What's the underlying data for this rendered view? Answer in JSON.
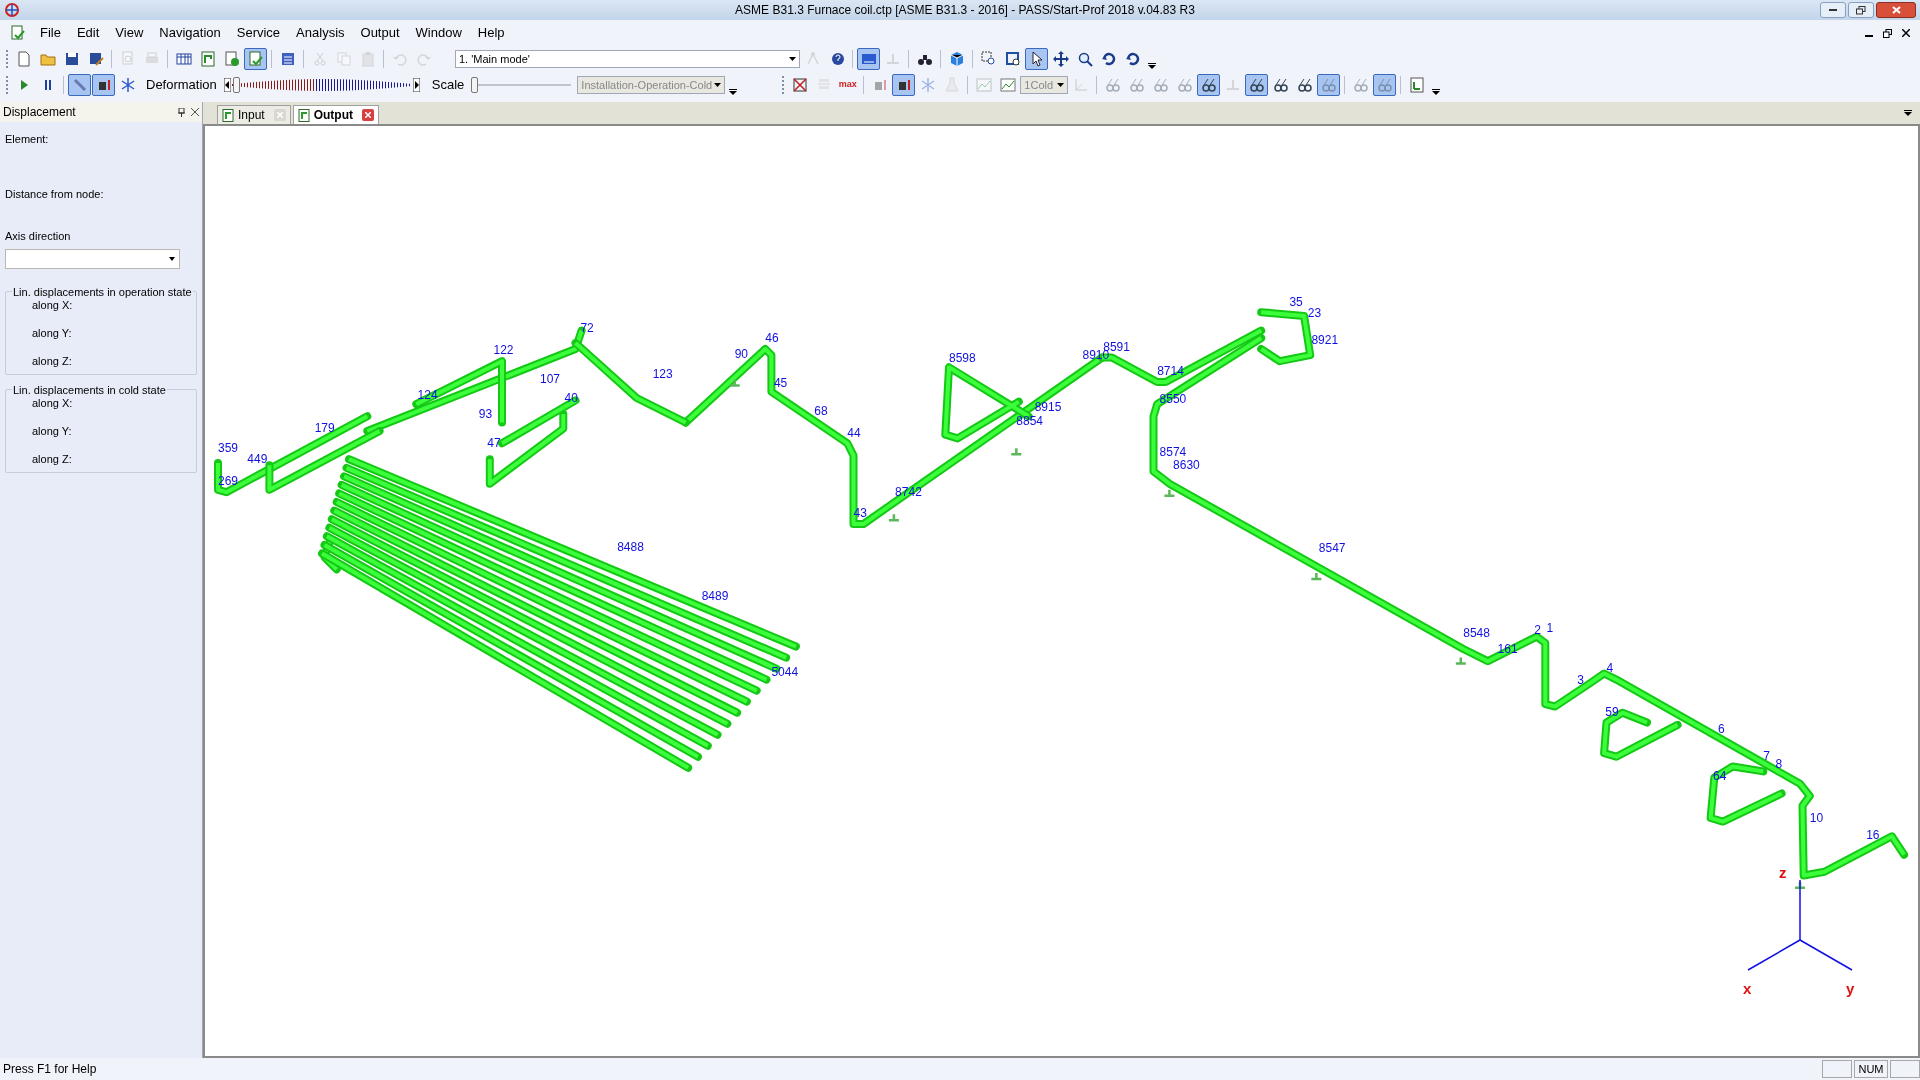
{
  "window": {
    "title": "ASME B31.3 Furnace coil.ctp [ASME B31.3 - 2016] - PASS/Start-Prof 2018 v.04.83 R3"
  },
  "menu": [
    "File",
    "Edit",
    "View",
    "Navigation",
    "Service",
    "Analysis",
    "Output",
    "Window",
    "Help"
  ],
  "toolbar_1": [
    {
      "kind": "new",
      "pressed": false,
      "disabled": false
    },
    {
      "kind": "open",
      "pressed": false,
      "disabled": false
    },
    {
      "kind": "save",
      "pressed": false,
      "disabled": false
    },
    {
      "kind": "saveas",
      "pressed": false,
      "disabled": false
    },
    {
      "kind": "sep"
    },
    {
      "kind": "preview",
      "pressed": false,
      "disabled": true
    },
    {
      "kind": "print",
      "pressed": false,
      "disabled": true
    },
    {
      "kind": "sep"
    },
    {
      "kind": "table",
      "pressed": false,
      "disabled": false
    },
    {
      "kind": "plan",
      "pressed": false,
      "disabled": false
    },
    {
      "kind": "check",
      "pressed": false,
      "disabled": false
    },
    {
      "kind": "calc",
      "pressed": true,
      "disabled": false
    },
    {
      "kind": "sep"
    },
    {
      "kind": "calculator",
      "pressed": false,
      "disabled": false
    },
    {
      "kind": "sep"
    },
    {
      "kind": "cut",
      "pressed": false,
      "disabled": true
    },
    {
      "kind": "copy",
      "pressed": false,
      "disabled": true
    },
    {
      "kind": "paste",
      "pressed": false,
      "disabled": true
    },
    {
      "kind": "sep"
    },
    {
      "kind": "undo",
      "pressed": false,
      "disabled": true
    },
    {
      "kind": "redo",
      "pressed": false,
      "disabled": true
    }
  ],
  "mode_select": "1. 'Main mode'",
  "toolbar_1b": [
    {
      "kind": "anchor",
      "pressed": false,
      "disabled": true
    },
    {
      "kind": "help",
      "pressed": false,
      "disabled": false
    },
    {
      "kind": "sep"
    },
    {
      "kind": "view3d",
      "pressed": true,
      "disabled": false
    },
    {
      "kind": "flat",
      "pressed": false,
      "disabled": true
    },
    {
      "kind": "sep"
    },
    {
      "kind": "binoculars",
      "pressed": false,
      "disabled": false
    },
    {
      "kind": "sep"
    },
    {
      "kind": "cube",
      "pressed": false,
      "disabled": false
    },
    {
      "kind": "sep"
    },
    {
      "kind": "zoomwin",
      "pressed": false,
      "disabled": false
    },
    {
      "kind": "zoomext",
      "pressed": false,
      "disabled": false
    },
    {
      "kind": "pointer",
      "pressed": true,
      "disabled": false
    },
    {
      "kind": "pan",
      "pressed": false,
      "disabled": false
    },
    {
      "kind": "zoom",
      "pressed": false,
      "disabled": false
    },
    {
      "kind": "rotate",
      "pressed": false,
      "disabled": false
    },
    {
      "kind": "rotate",
      "pressed": false,
      "disabled": false
    }
  ],
  "toolbar_2": [
    {
      "kind": "play",
      "pressed": false,
      "disabled": false
    },
    {
      "kind": "pause",
      "pressed": false,
      "disabled": false
    },
    {
      "kind": "sep"
    },
    {
      "kind": "wrench",
      "pressed": true,
      "disabled": false
    },
    {
      "kind": "weight",
      "pressed": true,
      "disabled": false
    },
    {
      "kind": "snow",
      "pressed": false,
      "disabled": false
    }
  ],
  "deformation": {
    "label": "Deformation",
    "level": 0
  },
  "scale": {
    "label": "Scale",
    "level": 0
  },
  "load_case_select": "Installation-Operation-Cold",
  "toolbar_2b": [
    {
      "kind": "nosupport",
      "pressed": false,
      "disabled": false
    },
    {
      "kind": "formula",
      "pressed": false,
      "disabled": true
    },
    {
      "kind": "max",
      "label": "max",
      "pressed": false,
      "disabled": false
    },
    {
      "kind": "sep"
    },
    {
      "kind": "weight",
      "pressed": false,
      "disabled": true
    },
    {
      "kind": "weight",
      "pressed": true,
      "disabled": false
    },
    {
      "kind": "snow",
      "pressed": false,
      "disabled": true
    },
    {
      "kind": "flask",
      "pressed": false,
      "disabled": true
    },
    {
      "kind": "sep"
    },
    {
      "kind": "chart",
      "pressed": false,
      "disabled": true
    },
    {
      "kind": "chart",
      "pressed": false,
      "disabled": false
    }
  ],
  "state_select": "1Cold",
  "toolbar_2c": [
    {
      "kind": "axes",
      "pressed": false,
      "disabled": true
    },
    {
      "kind": "sep"
    },
    {
      "kind": "glasses",
      "pressed": false,
      "disabled": true
    },
    {
      "kind": "glasses",
      "pressed": false,
      "disabled": true
    },
    {
      "kind": "glasses",
      "pressed": false,
      "disabled": true
    },
    {
      "kind": "glasses",
      "pressed": false,
      "disabled": true
    },
    {
      "kind": "glasses",
      "pressed": true,
      "disabled": false
    },
    {
      "kind": "flat",
      "pressed": false,
      "disabled": true
    },
    {
      "kind": "glasses",
      "pressed": true,
      "disabled": false
    },
    {
      "kind": "glasses",
      "pressed": false,
      "disabled": false
    },
    {
      "kind": "glasses",
      "pressed": false,
      "disabled": false
    },
    {
      "kind": "glasses",
      "pressed": true,
      "disabled": true
    },
    {
      "kind": "sep"
    },
    {
      "kind": "glasses",
      "pressed": false,
      "disabled": true
    },
    {
      "kind": "glasses",
      "pressed": true,
      "disabled": true
    },
    {
      "kind": "sep"
    },
    {
      "kind": "report",
      "pressed": false,
      "disabled": false
    }
  ],
  "panel": {
    "title": "Displacement",
    "fields": [
      "Element:",
      "Distance from node:"
    ],
    "axis_label": "Axis direction",
    "groups": [
      {
        "title": "Lin. displacements in operation state",
        "rows": [
          "along X:",
          "along Y:",
          "along Z:"
        ]
      },
      {
        "title": "Lin. displacements in cold state",
        "rows": [
          "along X:",
          "along Y:",
          "along Z:"
        ]
      }
    ]
  },
  "tabs": [
    {
      "label": "Input",
      "selected": false
    },
    {
      "label": "Output",
      "selected": true
    }
  ],
  "node_labels": [
    "46",
    "90",
    "45",
    "68",
    "44",
    "43",
    "8742",
    "8598",
    "8915",
    "8591",
    "8910",
    "8714",
    "8550",
    "8574",
    "8630",
    "35",
    "23",
    "8921",
    "8547",
    "8548",
    "161",
    "2",
    "1",
    "4",
    "3",
    "6",
    "7",
    "8",
    "10",
    "59",
    "64",
    "16",
    "122",
    "179",
    "359",
    "449",
    "269",
    "40",
    "123",
    "72",
    "124",
    "5044",
    "8489",
    "8488",
    "47",
    "93",
    "107",
    "8854"
  ],
  "axis_labels": [
    "z",
    "x",
    "y"
  ],
  "status_bar": {
    "help": "Press F1 for Help",
    "num": "NUM"
  }
}
